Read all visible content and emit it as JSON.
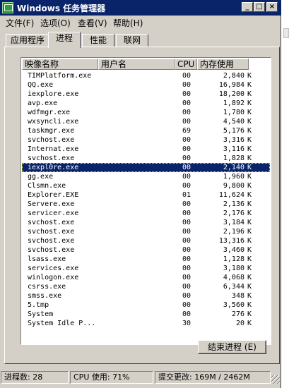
{
  "window": {
    "title": "Windows 任务管理器",
    "caption_buttons": {
      "minimize": "_",
      "maximize": "□",
      "close": "×"
    }
  },
  "menu": [
    "文件(F)",
    "选项(O)",
    "查看(V)",
    "帮助(H)"
  ],
  "tabs": [
    {
      "label": "应用程序",
      "active": false
    },
    {
      "label": "进程",
      "active": true
    },
    {
      "label": "性能",
      "active": false
    },
    {
      "label": "联网",
      "active": false
    }
  ],
  "process_list": {
    "columns": [
      "映像名称",
      "用户名",
      "CPU",
      "内存使用"
    ],
    "rows": [
      {
        "name": "TIMPlatform.exe",
        "cpu": "00",
        "mem": "2,840",
        "unit": "K"
      },
      {
        "name": "QQ.exe",
        "cpu": "00",
        "mem": "16,984",
        "unit": "K"
      },
      {
        "name": "iexplore.exe",
        "cpu": "00",
        "mem": "18,200",
        "unit": "K"
      },
      {
        "name": "avp.exe",
        "cpu": "00",
        "mem": "1,892",
        "unit": "K"
      },
      {
        "name": "wdfmgr.exe",
        "cpu": "00",
        "mem": "1,780",
        "unit": "K"
      },
      {
        "name": "wxsyncli.exe",
        "cpu": "00",
        "mem": "4,540",
        "unit": "K"
      },
      {
        "name": "taskmgr.exe",
        "cpu": "69",
        "mem": "5,176",
        "unit": "K"
      },
      {
        "name": "svchost.exe",
        "cpu": "00",
        "mem": "3,316",
        "unit": "K"
      },
      {
        "name": "Internat.exe",
        "cpu": "00",
        "mem": "3,116",
        "unit": "K"
      },
      {
        "name": "svchost.exe",
        "cpu": "00",
        "mem": "1,828",
        "unit": "K"
      },
      {
        "name": "iexpl0re.exe",
        "cpu": "00",
        "mem": "2,140",
        "unit": "K",
        "selected": true
      },
      {
        "name": "gg.exe",
        "cpu": "00",
        "mem": "1,960",
        "unit": "K"
      },
      {
        "name": "Clsmn.exe",
        "cpu": "00",
        "mem": "9,800",
        "unit": "K"
      },
      {
        "name": "Explorer.EXE",
        "cpu": "01",
        "mem": "11,624",
        "unit": "K"
      },
      {
        "name": "Servere.exe",
        "cpu": "00",
        "mem": "2,136",
        "unit": "K"
      },
      {
        "name": "servicer.exe",
        "cpu": "00",
        "mem": "2,176",
        "unit": "K"
      },
      {
        "name": "svchost.exe",
        "cpu": "00",
        "mem": "3,184",
        "unit": "K"
      },
      {
        "name": "svchost.exe",
        "cpu": "00",
        "mem": "2,196",
        "unit": "K"
      },
      {
        "name": "svchost.exe",
        "cpu": "00",
        "mem": "13,316",
        "unit": "K"
      },
      {
        "name": "svchost.exe",
        "cpu": "00",
        "mem": "3,460",
        "unit": "K"
      },
      {
        "name": "lsass.exe",
        "cpu": "00",
        "mem": "1,128",
        "unit": "K"
      },
      {
        "name": "services.exe",
        "cpu": "00",
        "mem": "3,180",
        "unit": "K"
      },
      {
        "name": "winlogon.exe",
        "cpu": "00",
        "mem": "4,068",
        "unit": "K"
      },
      {
        "name": "csrss.exe",
        "cpu": "00",
        "mem": "6,344",
        "unit": "K"
      },
      {
        "name": "smss.exe",
        "cpu": "00",
        "mem": "348",
        "unit": "K"
      },
      {
        "name": "5.tmp",
        "cpu": "00",
        "mem": "3,560",
        "unit": "K"
      },
      {
        "name": "System",
        "cpu": "00",
        "mem": "276",
        "unit": "K"
      },
      {
        "name": "System Idle P...",
        "cpu": "30",
        "mem": "20",
        "unit": "K"
      }
    ]
  },
  "end_process_button": "结束进程 (E)",
  "status": {
    "processes": "进程数: 28",
    "cpu": "CPU 使用: 71%",
    "commit": "提交更改: 169M / 2462M"
  }
}
